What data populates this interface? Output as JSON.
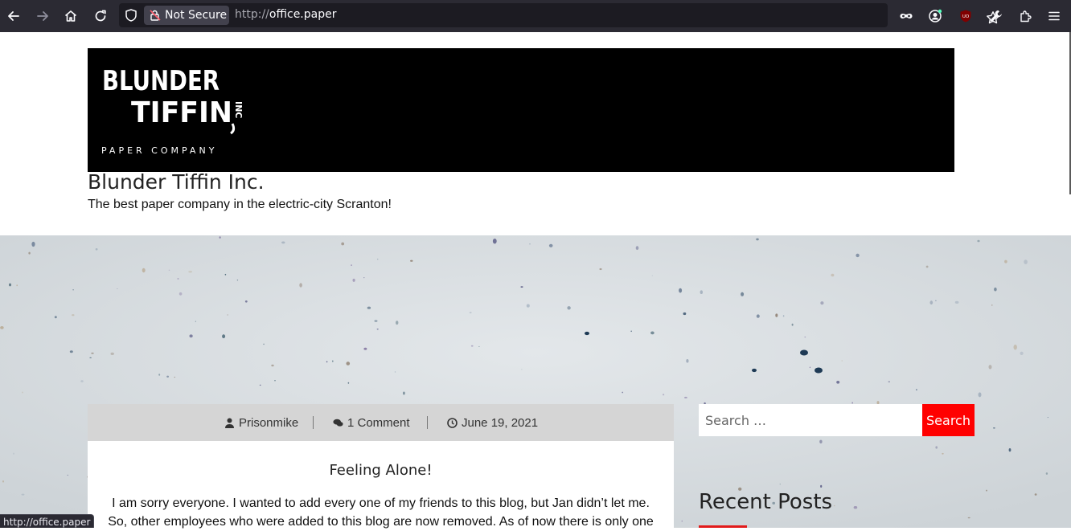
{
  "browser": {
    "security_label": "Not Secure",
    "url_scheme": "http://",
    "url_host": "office.paper",
    "icons": [
      "back-arrow-icon",
      "forward-arrow-icon",
      "home-icon",
      "reload-icon",
      "tracking-shield-icon",
      "insecure-lock-icon",
      "bookmark-star-icon",
      "private-mask-icon",
      "account-icon",
      "ublock-icon",
      "wrench-icon",
      "extensions-icon",
      "hamburger-menu-icon"
    ],
    "toolbar_color": "#2b2a33"
  },
  "site": {
    "logo_line1": "BLUNDER",
    "logo_line2": "TIFFIN",
    "logo_inc": "INC",
    "logo_line3": "PAPER COMPANY",
    "title": "Blunder Tiffin Inc.",
    "description": "The best paper company in the electric-city Scranton!"
  },
  "post": {
    "author": "Prisonmike",
    "comments": "1 Comment",
    "date": "June 19, 2021",
    "title": "Feeling Alone!",
    "excerpt": "I am sorry everyone. I wanted to add every one of my friends to this blog, but Jan didn’t let me. So, other employees who were added to this blog are now removed. As of now there is only one"
  },
  "sidebar": {
    "search_placeholder": "Search …",
    "search_button": "Search",
    "recent_posts_heading": "Recent Posts"
  },
  "status": {
    "hover_link": "http://office.paper"
  },
  "colors": {
    "accent_red": "#ff0000",
    "banner": "#000000",
    "meta_bar": "#d5d5d5"
  }
}
